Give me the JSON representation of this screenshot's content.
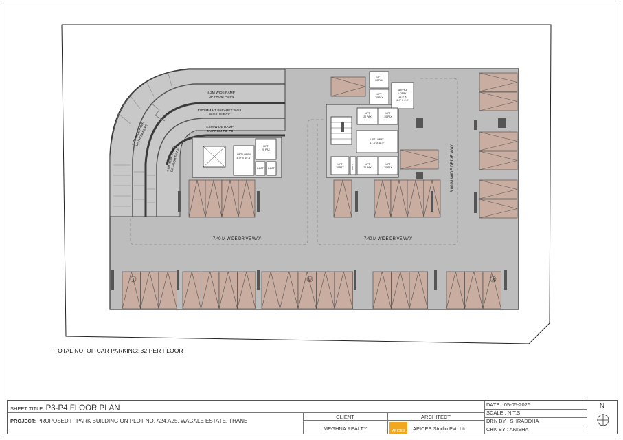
{
  "plan": {
    "ramp_labels": {
      "ramp_up_p3_p4": [
        "4.2M WIDE RAMP",
        "UP FROM P3-P4"
      ],
      "parapet": [
        "1200 MM HT PARAPET WALL",
        "WALL IN RCC"
      ],
      "ramp_dn_p3_p3": [
        "4.2M WIDE RAMP",
        "DN FROM P3 -P3"
      ],
      "curve_ramp_up": [
        "4.2M WIDE RAMP",
        "UP FROM P3-P3"
      ],
      "curve_ramp_dn": [
        "4.2M WIDE RAMP",
        "DN FROM P4-P3"
      ]
    },
    "rooms": {
      "lift_lobby_left": [
        "LIFT LOBBY",
        "8'-0\" X 10'-1\""
      ],
      "lift_left": [
        "LIFT",
        "20 PAX"
      ],
      "duct_1": "DUCT",
      "duct_2": "DUCT",
      "lift_top_1": [
        "LIFT",
        "20 PAX"
      ],
      "lift_top_2": [
        "LIFT",
        "20 PAX"
      ],
      "service_lobby": [
        "SERVICE",
        "LOBBY",
        "14'-9\" X",
        "6'-9\" X 4'-6\""
      ],
      "lift_mid_1": [
        "LIFT",
        "20 PAX"
      ],
      "lift_mid_2": [
        "LIFT",
        "20 PAX"
      ],
      "lift_lobby_right": [
        "LIFT LOBBY",
        "17'-6\" X 11'-9\""
      ],
      "lift_bot_1": [
        "LIFT",
        "20 PAX"
      ],
      "lift_bot_2": [
        "LIFT",
        "20 PAX"
      ],
      "lift_bot_3": [
        "LIFT",
        "20 PAX"
      ],
      "duct_3": "DUCT"
    },
    "drive_way_left": "7.40 M WIDE DRIVE WAY",
    "drive_way_right": "7.40 M WIDE DRIVE WAY",
    "drive_way_vertical": "6.00 M WIDE DRIVE WAY",
    "parking_numbers": [
      "1",
      "10",
      "18"
    ]
  },
  "note": "TOTAL NO. OF CAR PARKING: 32 PER FLOOR",
  "title_block": {
    "sheet_title_label": "SHEET TITLE:",
    "sheet_title": "P3-P4 FLOOR PLAN",
    "project_label": "PROJECT:",
    "project": "PROPOSED IT PARK BUILDING ON PLOT NO. A24,A25, WAGALE ESTATE, THANE",
    "client_label": "CLIENT",
    "client": "MEGHNA REALTY",
    "architect_label": "ARCHITECT",
    "architect": "APICES Studio Pvt. Ltd",
    "logo_text": "APICES",
    "date": "DATE :   05-05-2026",
    "scale": "SCALE :  N.T.S",
    "drn_by": "DRN BY : SHRADDHA",
    "chk_by": "CHK BY : ANISHA",
    "north": "N"
  },
  "colors": {
    "slab": "#bdbdbd",
    "parking": "#c9ada0",
    "ramp": "#c4c4c4",
    "wall": "#4a4a4a"
  }
}
